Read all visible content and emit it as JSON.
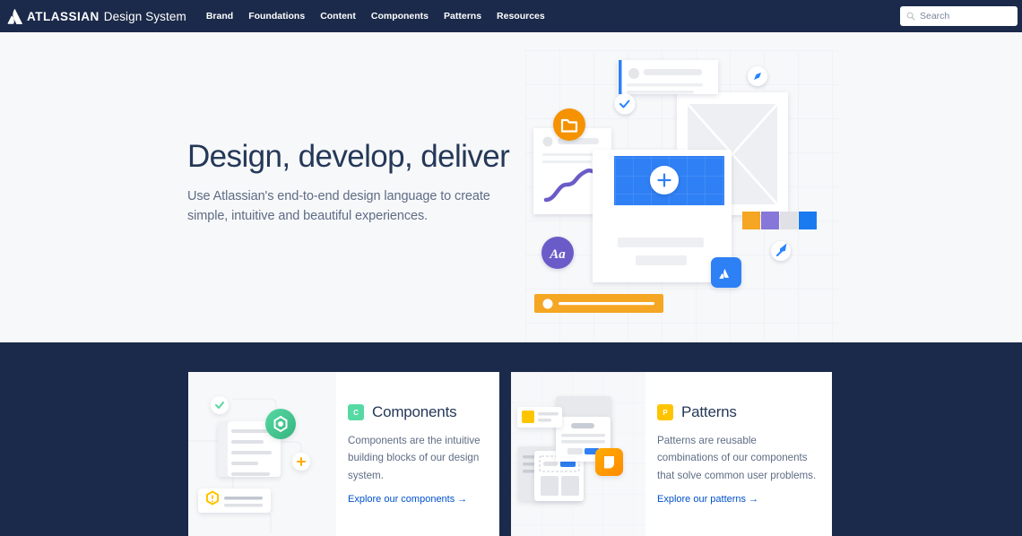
{
  "navbar": {
    "logo_icon": "atlassian-logo-mark",
    "brand_primary": "ATLASSIAN",
    "brand_secondary": "Design System",
    "links": [
      {
        "label": "Brand"
      },
      {
        "label": "Foundations"
      },
      {
        "label": "Content"
      },
      {
        "label": "Components"
      },
      {
        "label": "Patterns"
      },
      {
        "label": "Resources"
      }
    ],
    "search": {
      "icon": "search-icon",
      "placeholder": "Search",
      "value": ""
    },
    "background_color": "#1B2A4A"
  },
  "hero": {
    "title": "Design, develop, deliver",
    "subtitle": "Use Atlassian's end-to-end design language to create simple, intuitive and beautiful experiences.",
    "background_color": "#F7F8FA",
    "illustration": {
      "name": "design-system-hero-illustration",
      "badges": [
        {
          "icon": "folder-icon",
          "color": "#F59200"
        },
        {
          "icon": "check-icon",
          "color": "#2684FF"
        },
        {
          "icon": "pencil-icon",
          "color": "#2684FF"
        },
        {
          "icon": "typography-icon",
          "label": "Aa",
          "color": "#6B5BC8"
        },
        {
          "icon": "brush-icon",
          "color": "#2684FF"
        },
        {
          "icon": "atlassian-icon",
          "color": "#2F80F5"
        },
        {
          "icon": "plus-icon",
          "color": "#2F80F5"
        }
      ],
      "swatches": [
        "#F5A623",
        "#8777D9",
        "#DFE1E6",
        "#1A7BF0"
      ]
    }
  },
  "cards_section": {
    "background_color": "#1B2A4A",
    "cards": [
      {
        "chip_letter": "C",
        "chip_color": "#57D9A3",
        "title": "Components",
        "description": "Components are the intuitive building blocks of our design system.",
        "link_label": "Explore our components →",
        "link_color": "#0052CC",
        "illustration": "components-card-illustration"
      },
      {
        "chip_letter": "P",
        "chip_color": "#FFC400",
        "title": "Patterns",
        "description": "Patterns are reusable combinations of our components that solve common user problems.",
        "link_label": "Explore our patterns →",
        "link_color": "#0052CC",
        "illustration": "patterns-card-illustration"
      }
    ]
  }
}
